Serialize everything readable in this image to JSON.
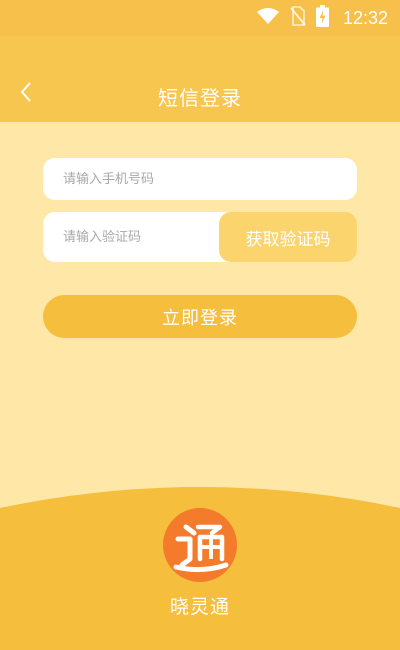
{
  "status_bar": {
    "time": "12:32",
    "icons": [
      "wifi-icon",
      "no-sim-icon",
      "battery-charging-icon"
    ]
  },
  "header": {
    "back_icon": "chevron-left-icon",
    "title": "短信登录"
  },
  "form": {
    "phone_placeholder": "请输入手机号码",
    "phone_value": "",
    "code_placeholder": "请输入验证码",
    "code_value": "",
    "get_code_label": "获取验证码",
    "login_label": "立即登录"
  },
  "app": {
    "name": "晓灵通",
    "logo_icon": "app-logo-icon"
  },
  "colors": {
    "background": "#FFE7A8",
    "header": "#F7C64F",
    "primary_button": "#F5BE3C",
    "secondary_button": "#FBD46E",
    "logo": "#F47A2C"
  }
}
